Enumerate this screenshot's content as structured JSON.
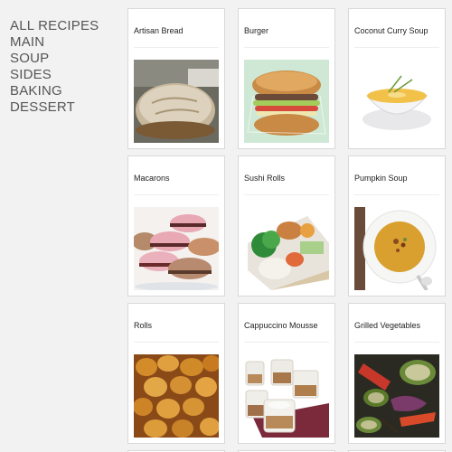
{
  "nav": {
    "items": [
      "ALL RECIPES",
      "MAIN",
      "SOUP",
      "SIDES",
      "BAKING",
      "DESSERT"
    ]
  },
  "recipes": [
    {
      "title": "Artisan Bread",
      "image": "artisan-bread-photo"
    },
    {
      "title": "Burger",
      "image": "burger-photo"
    },
    {
      "title": "Coconut Curry Soup",
      "image": "coconut-curry-soup-photo"
    },
    {
      "title": "Macarons",
      "image": "macarons-photo"
    },
    {
      "title": "Sushi Rolls",
      "image": "sushi-rolls-photo"
    },
    {
      "title": "Pumpkin Soup",
      "image": "pumpkin-soup-photo"
    },
    {
      "title": "Rolls",
      "image": "rolls-photo"
    },
    {
      "title": "Cappuccino Mousse",
      "image": "cappuccino-mousse-photo"
    },
    {
      "title": "Grilled Vegetables",
      "image": "grilled-vegetables-photo"
    }
  ]
}
